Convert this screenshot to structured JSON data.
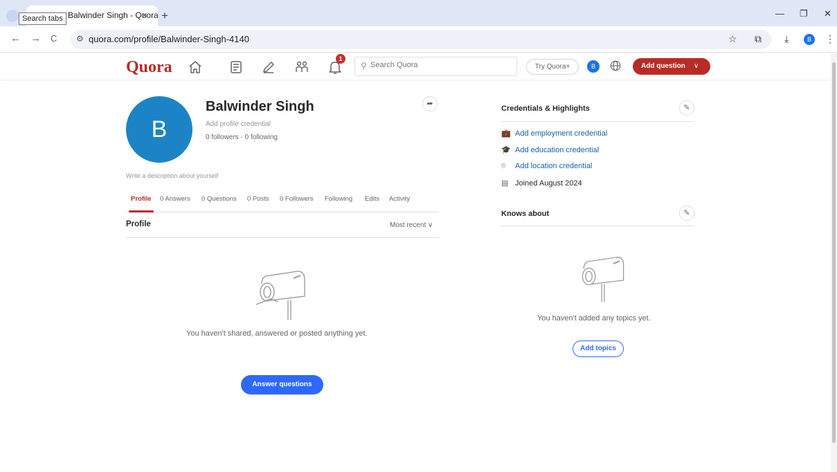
{
  "browser": {
    "tooltip": "Search tabs",
    "tab_title": "Balwinder Singh - Quora",
    "tab_close": "×",
    "new_tab": "+",
    "url_display": "quora.com/profile/Balwinder-Singh-4140",
    "profile_initial": "B",
    "window": {
      "minimize": "—",
      "restore": "❐",
      "close": "✕"
    }
  },
  "header": {
    "logo": "Quora",
    "notification_count": "1",
    "search_placeholder": "Search Quora",
    "try_plus": "Try Quora+",
    "avatar_initial": "B",
    "add_question": "Add question"
  },
  "profile": {
    "avatar_letter": "B",
    "name": "Balwinder Singh",
    "credential_prompt": "Add profile credential",
    "follow_stats": "0 followers · 0 following",
    "description_prompt": "Write a description about yourself",
    "tabs": [
      "Profile",
      "0 Answers",
      "0 Questions",
      "0 Posts",
      "0 Followers",
      "Following",
      "Edits",
      "Activity"
    ],
    "section_title": "Profile",
    "sort_label": "Most recent",
    "empty_message": "You haven't shared, answered or posted anything yet.",
    "answer_button": "Answer questions"
  },
  "sidebar": {
    "credentials_title": "Credentials & Highlights",
    "credentials": [
      {
        "label": "Add employment credential",
        "icon": "briefcase-icon"
      },
      {
        "label": "Add education credential",
        "icon": "graduation-cap-icon"
      },
      {
        "label": "Add location credential",
        "icon": "location-pin-icon"
      },
      {
        "label": "Joined August 2024",
        "icon": "calendar-icon"
      }
    ],
    "knows_title": "Knows about",
    "knows_empty": "You haven't added any topics yet.",
    "add_topics": "Add topics"
  },
  "colors": {
    "brand": "#b92b27",
    "primary_blue": "#2e69ff",
    "link_blue": "#195faa",
    "avatar_blue": "#1c84c6"
  }
}
